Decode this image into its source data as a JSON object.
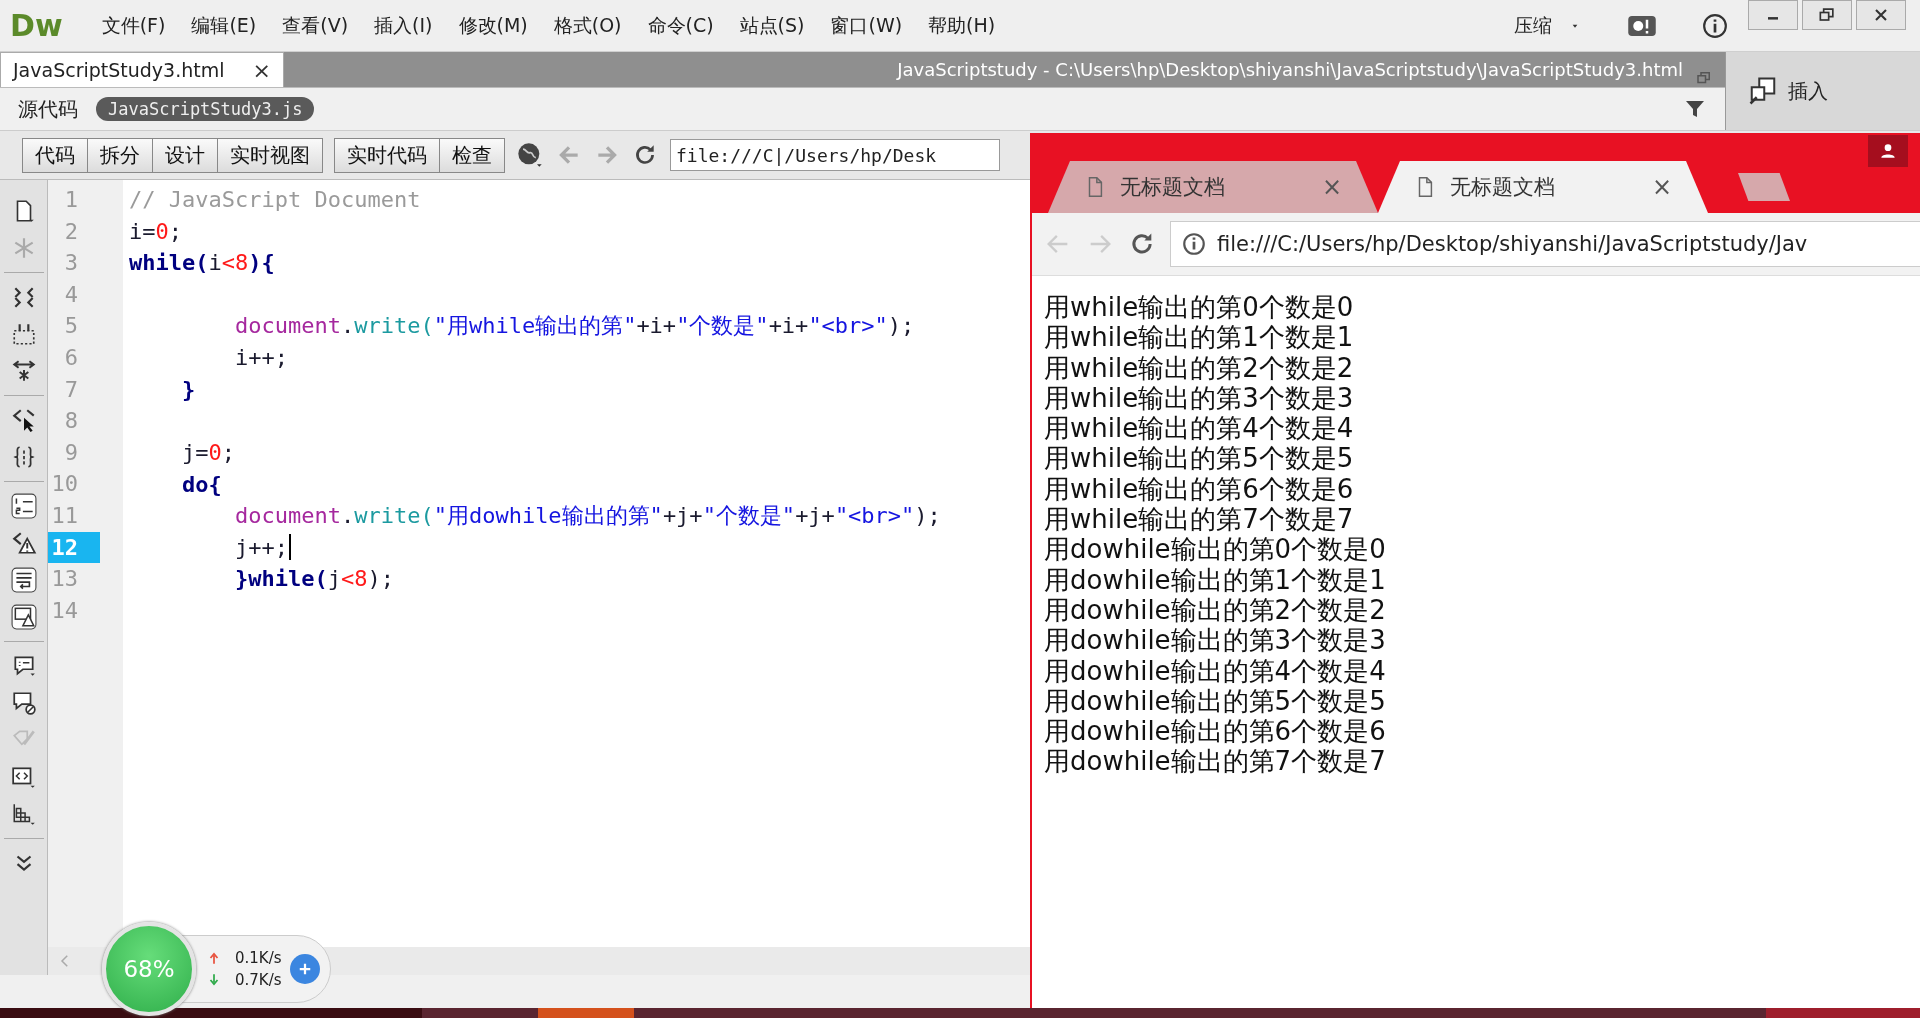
{
  "app": {
    "logo": "Dw",
    "menu": [
      "文件(F)",
      "编辑(E)",
      "查看(V)",
      "插入(I)",
      "修改(M)",
      "格式(O)",
      "命令(C)",
      "站点(S)",
      "窗口(W)",
      "帮助(H)"
    ],
    "compress": "压缩"
  },
  "document_tab": {
    "title": "JavaScriptStudy3.html",
    "close": "×"
  },
  "path": "JavaScriptstudy - C:\\Users\\hp\\Desktop\\shiyanshi\\JavaScriptstudy\\JavaScriptStudy3.html",
  "source_bar": {
    "label": "源代码",
    "related_file": "JavaScriptStudy3.js"
  },
  "insert_panel": {
    "label": "插入"
  },
  "view_buttons": [
    "代码",
    "拆分",
    "设计",
    "实时视图"
  ],
  "inspect_buttons": [
    "实时代码",
    "检查"
  ],
  "address": "file:///C|/Users/hp/Desk",
  "code": {
    "lines": [
      {
        "number": "1",
        "selected": false,
        "tokens": [
          {
            "kind": "comment",
            "text": "// JavaScript Document"
          }
        ]
      },
      {
        "number": "2",
        "selected": false,
        "tokens": [
          {
            "kind": "plain",
            "text": "i="
          },
          {
            "kind": "number",
            "text": "0"
          },
          {
            "kind": "plain",
            "text": ";"
          }
        ]
      },
      {
        "number": "3",
        "selected": false,
        "tokens": [
          {
            "kind": "keyword",
            "text": "while("
          },
          {
            "kind": "plain",
            "text": "i"
          },
          {
            "kind": "number",
            "text": "<8"
          },
          {
            "kind": "keyword",
            "text": "){"
          }
        ]
      },
      {
        "number": "4",
        "selected": false
      },
      {
        "number": "5",
        "selected": false,
        "tokens": [
          {
            "kind": "object",
            "text": "        document"
          },
          {
            "kind": "plain",
            "text": "."
          },
          {
            "kind": "method",
            "text": "write("
          },
          {
            "kind": "string",
            "text": "\"用while输出的第\""
          },
          {
            "kind": "plain",
            "text": "+i+"
          },
          {
            "kind": "string",
            "text": "\"个数是\""
          },
          {
            "kind": "plain",
            "text": "+i+"
          },
          {
            "kind": "string",
            "text": "\"<br>\""
          },
          {
            "kind": "plain",
            "text": ");"
          }
        ]
      },
      {
        "number": "6",
        "selected": false,
        "tokens": [
          {
            "kind": "plain",
            "text": "        i++;"
          }
        ]
      },
      {
        "number": "7",
        "selected": false,
        "tokens": [
          {
            "kind": "keyword",
            "text": "    }"
          }
        ]
      },
      {
        "number": "8",
        "selected": false
      },
      {
        "number": "9",
        "selected": false,
        "tokens": [
          {
            "kind": "plain",
            "text": "    j="
          },
          {
            "kind": "number",
            "text": "0"
          },
          {
            "kind": "plain",
            "text": ";"
          }
        ]
      },
      {
        "number": "10",
        "selected": false,
        "tokens": [
          {
            "kind": "keyword",
            "text": "    do{"
          }
        ]
      },
      {
        "number": "11",
        "selected": false,
        "tokens": [
          {
            "kind": "object",
            "text": "        document"
          },
          {
            "kind": "plain",
            "text": "."
          },
          {
            "kind": "method",
            "text": "write("
          },
          {
            "kind": "string",
            "text": "\"用dowhile输出的第\""
          },
          {
            "kind": "plain",
            "text": "+j+"
          },
          {
            "kind": "string",
            "text": "\"个数是\""
          },
          {
            "kind": "plain",
            "text": "+j+"
          },
          {
            "kind": "string",
            "text": "\"<br>\""
          },
          {
            "kind": "plain",
            "text": ");"
          }
        ]
      },
      {
        "number": "12",
        "selected": true,
        "tokens": [
          {
            "kind": "plain",
            "text": "        j++;"
          }
        ]
      },
      {
        "number": "13",
        "selected": false,
        "tokens": [
          {
            "kind": "keyword",
            "text": "        }while("
          },
          {
            "kind": "plain",
            "text": "j"
          },
          {
            "kind": "number",
            "text": "<8"
          },
          {
            "kind": "plain",
            "text": ");"
          }
        ]
      },
      {
        "number": "14",
        "selected": false
      }
    ]
  },
  "network_widget": {
    "percent": "68%",
    "upload": "0.1K/s",
    "download": "0.7K/s"
  },
  "browser": {
    "tabs": [
      {
        "title": "无标题文档",
        "close": "×",
        "selected": false
      },
      {
        "title": "无标题文档",
        "close": "×",
        "selected": true
      }
    ],
    "address": "file:///C:/Users/hp/Desktop/shiyanshi/JavaScriptstudy/Jav",
    "output": [
      "用while输出的第0个数是0",
      "用while输出的第1个数是1",
      "用while输出的第2个数是2",
      "用while输出的第3个数是3",
      "用while输出的第4个数是4",
      "用while输出的第5个数是5",
      "用while输出的第6个数是6",
      "用while输出的第7个数是7",
      "用dowhile输出的第0个数是0",
      "用dowhile输出的第1个数是1",
      "用dowhile输出的第2个数是2",
      "用dowhile输出的第3个数是3",
      "用dowhile输出的第4个数是4",
      "用dowhile输出的第5个数是5",
      "用dowhile输出的第6个数是6",
      "用dowhile输出的第7个数是7"
    ]
  }
}
